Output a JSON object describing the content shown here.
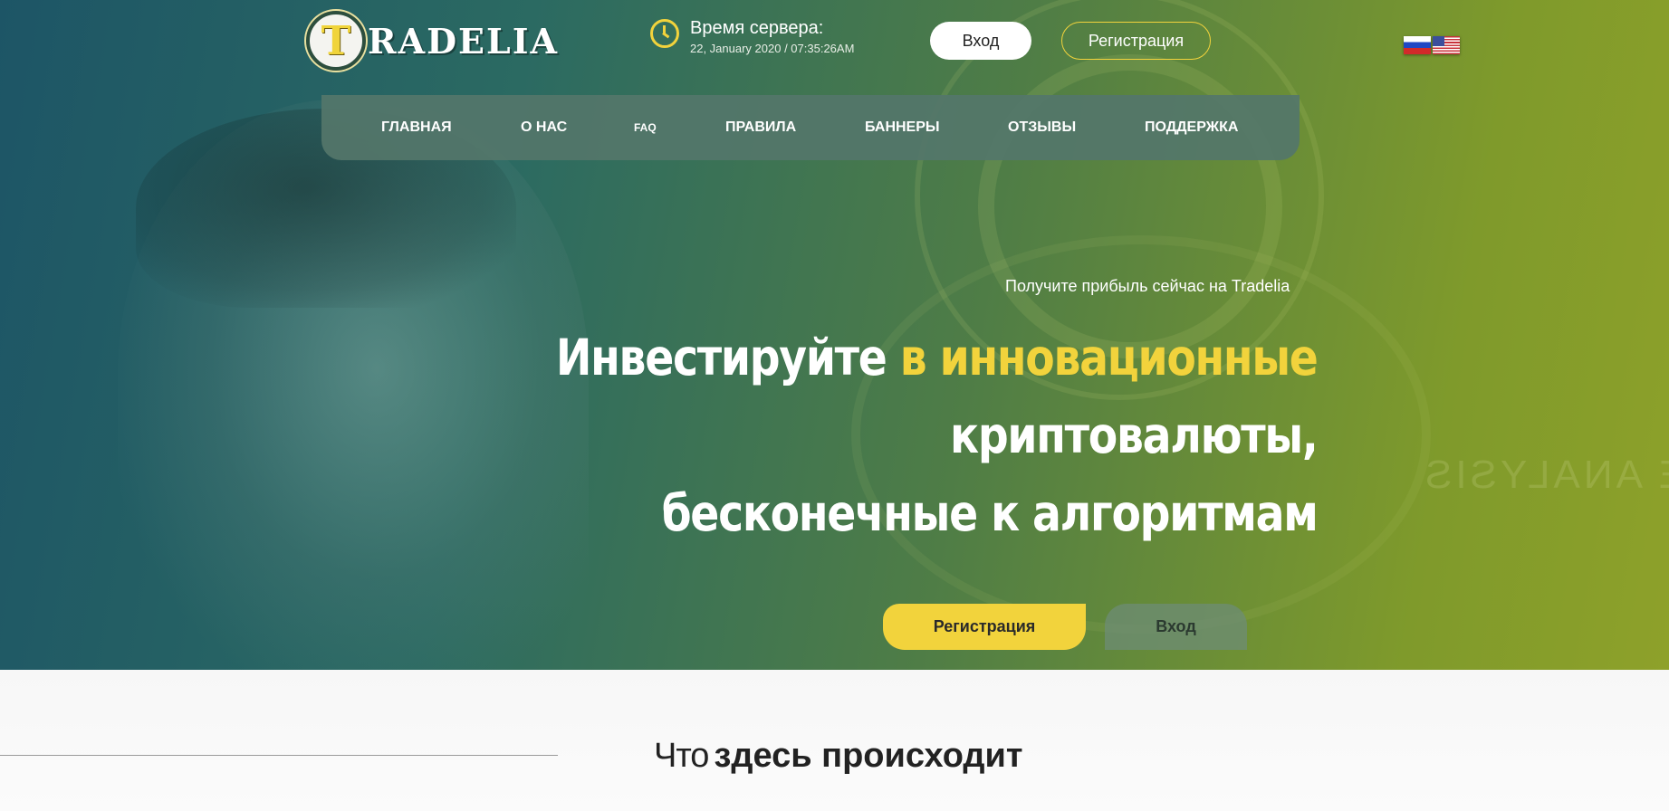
{
  "brand": {
    "logo_letter": "T",
    "name": "RADELIA"
  },
  "server_time": {
    "label": "Время сервера:",
    "value": "22, January 2020 / 07:35:26AM"
  },
  "header": {
    "login_label": "Вход",
    "register_label": "Регистрация"
  },
  "languages": [
    {
      "code": "ru",
      "icon": "flag-russia-icon"
    },
    {
      "code": "en",
      "icon": "flag-usa-icon"
    }
  ],
  "nav": {
    "items": [
      {
        "label": "ГЛАВНАЯ"
      },
      {
        "label": "О НАС"
      },
      {
        "label": "FAQ"
      },
      {
        "label": "ПРАВИЛА"
      },
      {
        "label": "БАННЕРЫ"
      },
      {
        "label": "ОТЗЫВЫ"
      },
      {
        "label": "ПОДДЕРЖКА"
      }
    ]
  },
  "hero": {
    "subtitle": "Получите прибыль сейчас на Tradelia",
    "title_part1": "Инвестируйте",
    "title_accent": "в инновационные",
    "title_line2": "криптовалюты,",
    "title_line3": "бесконечные к алгоритмам",
    "watermark": "COMPLETE ANALYSIS",
    "register_label": "Регистрация",
    "login_label": "Вход"
  },
  "section": {
    "title_light": "Что",
    "title_bold": "здесь происходит"
  },
  "colors": {
    "accent": "#f2d33c",
    "nav_bg": "#54766a"
  }
}
